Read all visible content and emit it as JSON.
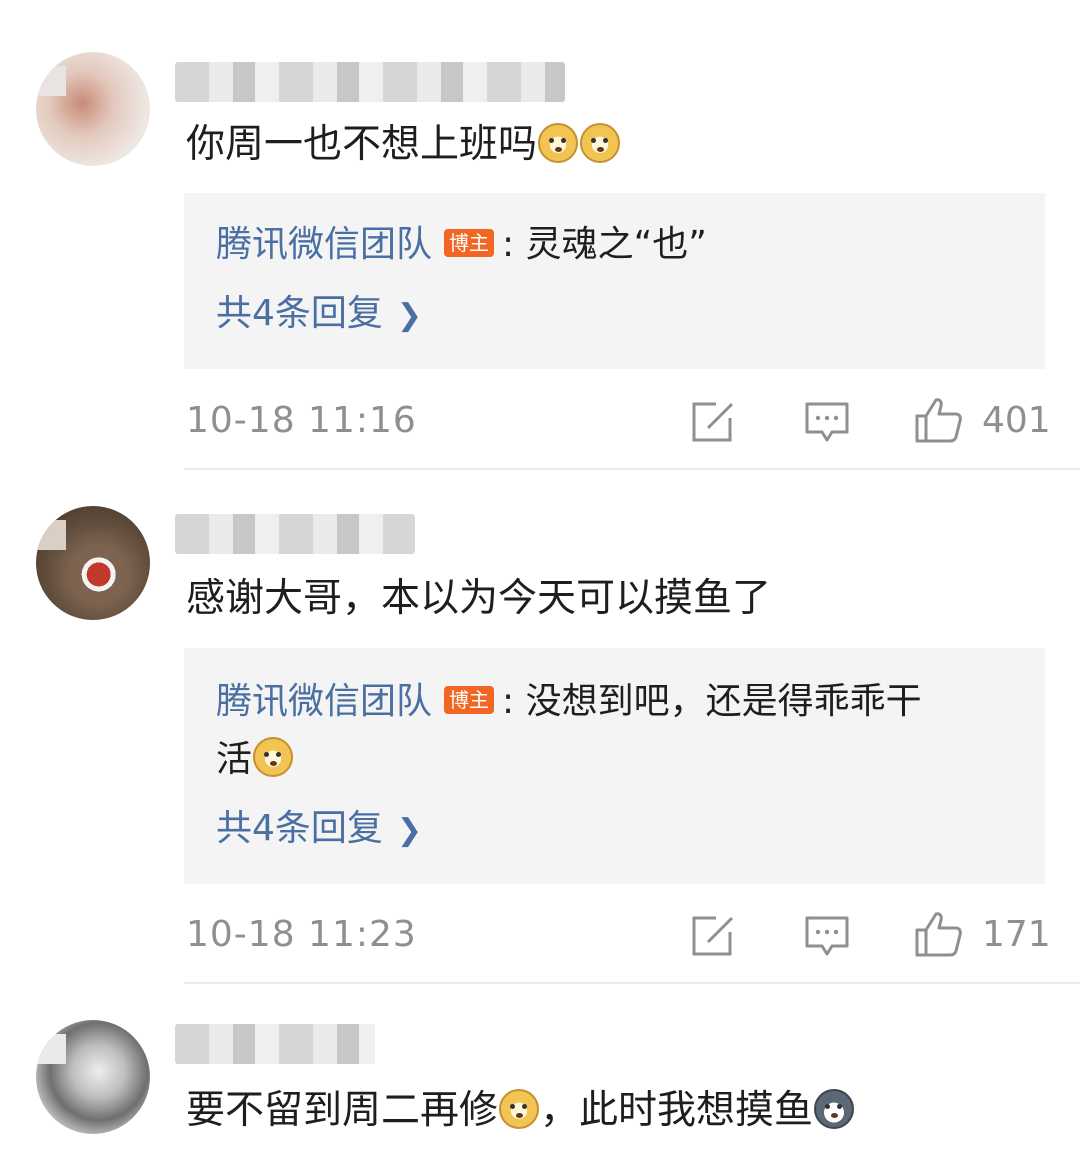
{
  "comments": [
    {
      "text": "你周一也不想上班吗",
      "emojis": [
        "doge-emoji",
        "doge-emoji"
      ],
      "reply": {
        "author": "腾讯微信团队",
        "badge": "博主",
        "text": ": 灵魂之“也”",
        "text_cont": "",
        "more": "共4条回复"
      },
      "time": "10-18 11:16",
      "likes": "401"
    },
    {
      "text": "感谢大哥，本以为今天可以摸鱼了",
      "reply": {
        "author": "腾讯微信团队",
        "badge": "博主",
        "text": ": 没想到吧，还是得乖乖干",
        "text_cont": "活",
        "more": "共4条回复"
      },
      "time": "10-18 11:23",
      "likes": "171"
    },
    {
      "text_a": "要不留到周二再修",
      "text_b": "，此时我想摸鱼"
    }
  ],
  "icons": {
    "share": "share-edit-icon",
    "reply": "comment-bubble-icon",
    "like": "thumbs-up-icon",
    "chevron": "chevron-right-icon"
  },
  "colors": {
    "link": "#4a6fa3",
    "badge": "#f26522",
    "meta": "#8f8f8f",
    "reply_bg": "#f4f4f4"
  }
}
